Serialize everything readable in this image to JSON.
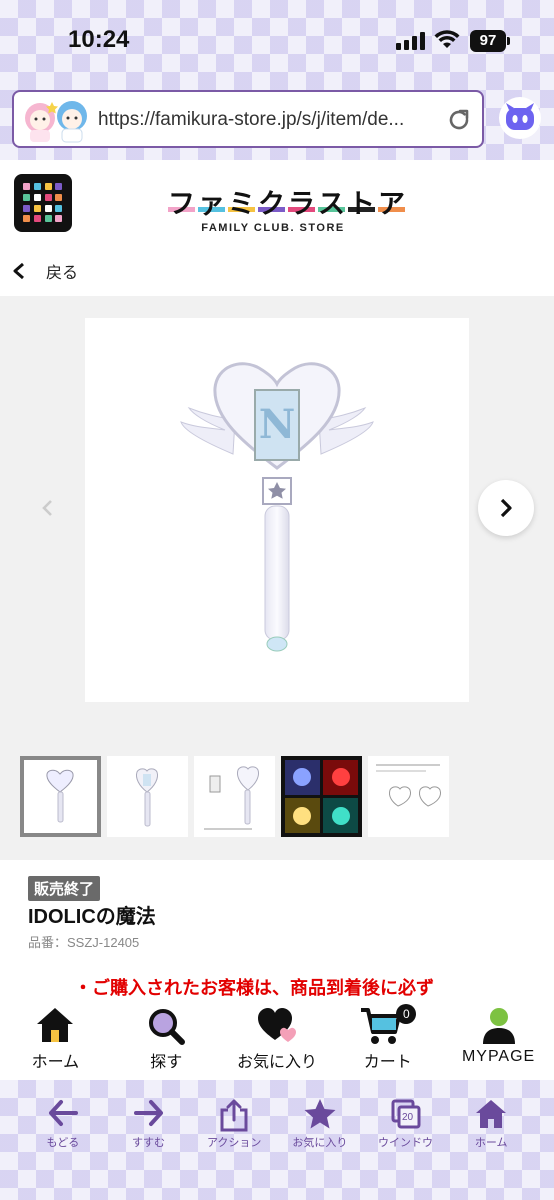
{
  "status_bar": {
    "time": "10:24",
    "battery": "97"
  },
  "browser": {
    "url": "https://famikura-store.jp/s/j/item/de..."
  },
  "header": {
    "logo_kana": [
      "フ",
      "ァ",
      "ミ",
      "ク",
      "ラ",
      "ス",
      "ト",
      "ア"
    ],
    "logo_sub": "FAMILY CLUB. STORE",
    "logo_colors": [
      "#f2a3c8",
      "#55c1e0",
      "#f6c342",
      "#7c5cc8",
      "#e34a7d",
      "#59c59a",
      "#222222",
      "#f08e4b"
    ]
  },
  "nav": {
    "back_label": "戻る"
  },
  "product": {
    "status_badge": "販売終了",
    "name": "IDOLICの魔法",
    "code": "品番：SSZJ-12405",
    "notice": "・ご購入されたお客様は、商品到着後に必ず"
  },
  "site_nav": {
    "items": [
      {
        "label": "ホーム",
        "icon": "home-icon"
      },
      {
        "label": "探す",
        "icon": "search-icon"
      },
      {
        "label": "お気に入り",
        "icon": "heart-icon"
      },
      {
        "label": "カート",
        "icon": "cart-icon",
        "count": "0"
      },
      {
        "label": "MYPAGE",
        "icon": "user-icon"
      }
    ],
    "accent_purple": "#7e5fbd",
    "accent_green": "#7dc242"
  },
  "toolbar": {
    "items": [
      {
        "label": "もどる",
        "icon": "arrow-left-icon"
      },
      {
        "label": "すすむ",
        "icon": "arrow-right-icon"
      },
      {
        "label": "アクション",
        "icon": "share-icon"
      },
      {
        "label": "お気に入り",
        "icon": "star-icon"
      },
      {
        "label": "ウインドウ",
        "icon": "tabs-icon",
        "count": "20"
      },
      {
        "label": "ホーム",
        "icon": "home-icon"
      }
    ],
    "color": "#6a4a9c"
  }
}
